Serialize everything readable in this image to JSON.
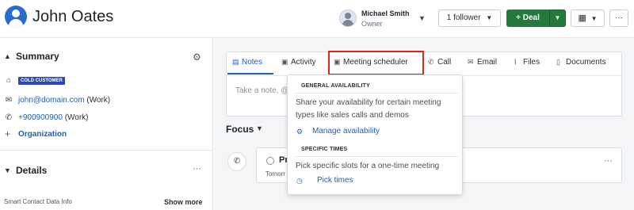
{
  "contact": {
    "name": "John Oates"
  },
  "header": {
    "owner_name": "Michael Smith",
    "owner_role": "Owner",
    "follower_label": "1 follower",
    "deal_label": "+ Deal",
    "more_label": "···"
  },
  "sidebar": {
    "summary_title": "Summary",
    "badge": "COLD CUSTOMER",
    "email": "john@domain.com",
    "email_type": "(Work)",
    "phone": "+900900900",
    "phone_type": "(Work)",
    "organization_label": "Organization",
    "details_title": "Details",
    "details_dots": "···",
    "smart_info": "Smart Contact Data Info",
    "show_more": "Show more"
  },
  "tabs": [
    {
      "label": "Notes",
      "icon": "notes-icon"
    },
    {
      "label": "Activity",
      "icon": "calendar-icon"
    },
    {
      "label": "Meeting scheduler",
      "icon": "calendar-clock-icon"
    },
    {
      "label": "Call",
      "icon": "phone-icon"
    },
    {
      "label": "Email",
      "icon": "envelope-icon"
    },
    {
      "label": "Files",
      "icon": "paperclip-icon"
    },
    {
      "label": "Documents",
      "icon": "document-icon"
    }
  ],
  "note": {
    "placeholder": "Take a note, @"
  },
  "focus": {
    "title": "Focus",
    "activity_title": "Pr",
    "activity_sub": "Tomorr",
    "dots": "···"
  },
  "popup": {
    "general_heading": "GENERAL AVAILABILITY",
    "general_desc": "Share your availability for certain meeting types like sales calls and demos",
    "general_link": "Manage availability",
    "specific_heading": "SPECIFIC TIMES",
    "specific_desc": "Pick specific slots for a one-time meeting",
    "specific_link": "Pick times"
  },
  "colors": {
    "accent": "#1f5fbf",
    "deal_green": "#237a3a",
    "badge_blue": "#2b49b8",
    "highlight_red": "#e0261a"
  }
}
